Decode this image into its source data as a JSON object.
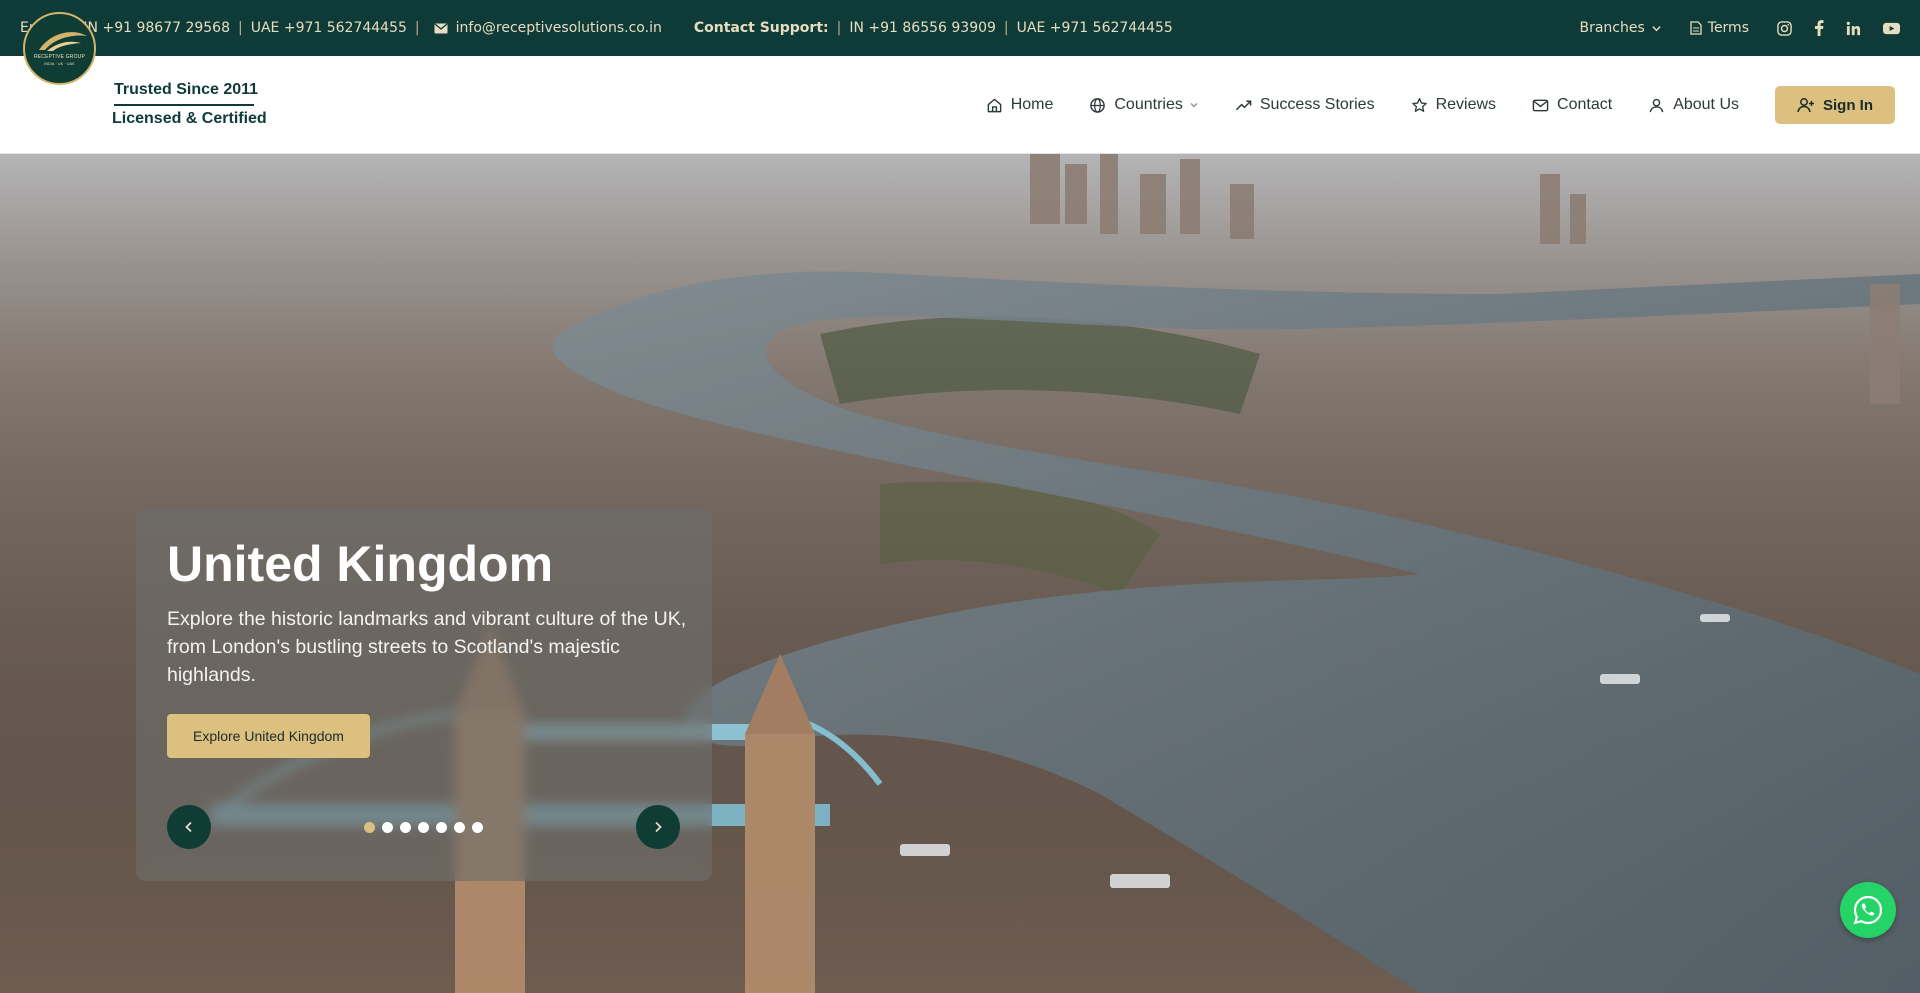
{
  "topbar": {
    "enquiry_label": "Enquiry",
    "enquiry_in": "IN +91 98677 29568",
    "enquiry_uae": "UAE +971 562744455",
    "email": "info@receptivesolutions.co.in",
    "support_label": "Contact Support:",
    "support_in": "IN +91 86556 93909",
    "support_uae": "UAE +971 562744455",
    "branches_label": "Branches",
    "terms_label": "Terms",
    "separator": "|",
    "social_icons": [
      "instagram-icon",
      "facebook-icon",
      "linkedin-icon",
      "youtube-icon"
    ]
  },
  "header": {
    "logo_text": "RECEPTIVE GROUP",
    "logo_sub": "INDIA · UK · UAE",
    "trust_line1": "Trusted Since 2011",
    "trust_line2": "Licensed & Certified",
    "nav": {
      "home": "Home",
      "countries": "Countries",
      "success": "Success Stories",
      "reviews": "Reviews",
      "contact": "Contact",
      "about": "About Us"
    },
    "signin": "Sign In"
  },
  "hero": {
    "title": "United Kingdom",
    "description": "Explore the historic landmarks and vibrant culture of the UK, from London's bustling streets to Scotland's majestic highlands.",
    "button": "Explore United Kingdom",
    "slide_count": 7,
    "active_slide": 1
  },
  "colors": {
    "dark_green": "#0e3b37",
    "gold": "#dcc07f",
    "whatsapp": "#25d366"
  }
}
